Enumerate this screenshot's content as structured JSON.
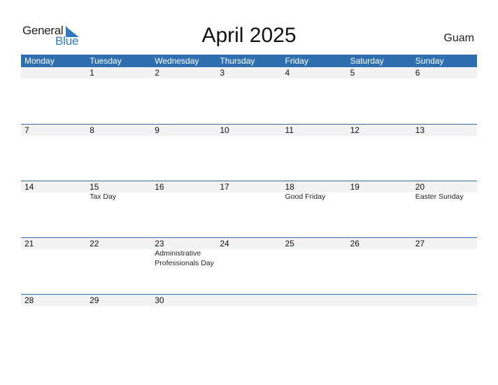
{
  "logo": {
    "word1": "General",
    "word2": "Blue"
  },
  "title": "April 2025",
  "region": "Guam",
  "colors": {
    "header_bg": "#2e6fb0",
    "logo_blue": "#2e79c2",
    "day_row_bg": "#f2f2f2"
  },
  "weekdays": [
    "Monday",
    "Tuesday",
    "Wednesday",
    "Thursday",
    "Friday",
    "Saturday",
    "Sunday"
  ],
  "weeks": [
    {
      "days": [
        {
          "num": "",
          "event": ""
        },
        {
          "num": "1",
          "event": ""
        },
        {
          "num": "2",
          "event": ""
        },
        {
          "num": "3",
          "event": ""
        },
        {
          "num": "4",
          "event": ""
        },
        {
          "num": "5",
          "event": ""
        },
        {
          "num": "6",
          "event": ""
        }
      ]
    },
    {
      "days": [
        {
          "num": "7",
          "event": ""
        },
        {
          "num": "8",
          "event": ""
        },
        {
          "num": "9",
          "event": ""
        },
        {
          "num": "10",
          "event": ""
        },
        {
          "num": "11",
          "event": ""
        },
        {
          "num": "12",
          "event": ""
        },
        {
          "num": "13",
          "event": ""
        }
      ]
    },
    {
      "days": [
        {
          "num": "14",
          "event": ""
        },
        {
          "num": "15",
          "event": "Tax Day"
        },
        {
          "num": "16",
          "event": ""
        },
        {
          "num": "17",
          "event": ""
        },
        {
          "num": "18",
          "event": "Good Friday"
        },
        {
          "num": "19",
          "event": ""
        },
        {
          "num": "20",
          "event": "Easter Sunday"
        }
      ]
    },
    {
      "days": [
        {
          "num": "21",
          "event": ""
        },
        {
          "num": "22",
          "event": ""
        },
        {
          "num": "23",
          "event": "Administrative Professionals Day"
        },
        {
          "num": "24",
          "event": ""
        },
        {
          "num": "25",
          "event": ""
        },
        {
          "num": "26",
          "event": ""
        },
        {
          "num": "27",
          "event": ""
        }
      ]
    },
    {
      "days": [
        {
          "num": "28",
          "event": ""
        },
        {
          "num": "29",
          "event": ""
        },
        {
          "num": "30",
          "event": ""
        },
        {
          "num": "",
          "event": ""
        },
        {
          "num": "",
          "event": ""
        },
        {
          "num": "",
          "event": ""
        },
        {
          "num": "",
          "event": ""
        }
      ]
    }
  ]
}
